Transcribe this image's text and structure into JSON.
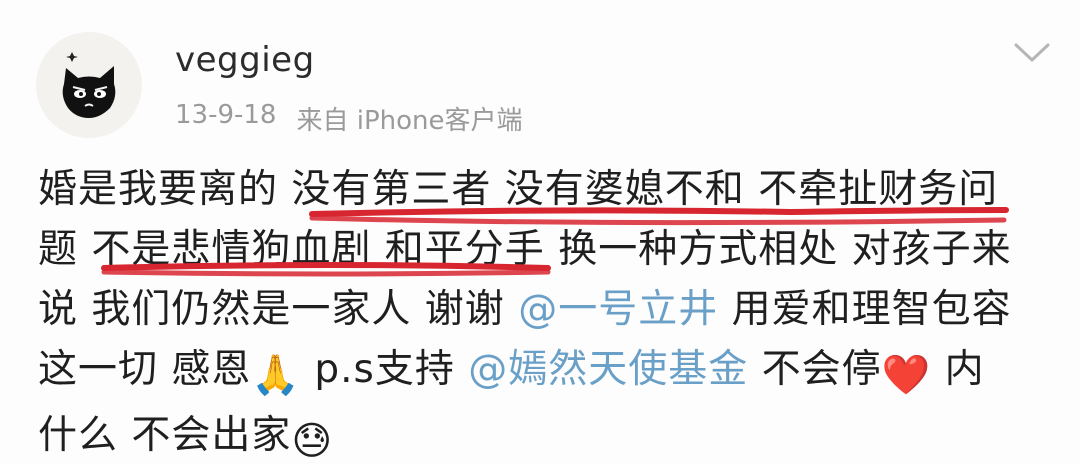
{
  "post": {
    "username": "veggieg",
    "date": "13-9-18",
    "source": "来自 iPhone客户端",
    "body_lines": [
      [
        {
          "t": "婚是我要离的 没有第三者 没有婆媳不和 不牵扯财务问",
          "m": false
        }
      ],
      [
        {
          "t": "题 不是悲情狗血剧 和平分手 换一种方式相处 对孩子来",
          "m": false
        }
      ],
      [
        {
          "t": "说 我们仍然是一家人 谢谢 ",
          "m": false
        },
        {
          "t": "@一号立井",
          "m": true
        },
        {
          "t": " 用爱和理智包容",
          "m": false
        }
      ],
      [
        {
          "t": "这一切 感恩",
          "m": false
        },
        {
          "t": "🙏",
          "e": "praying-hands-emoji"
        },
        {
          "t": " p.s支持 ",
          "m": false
        },
        {
          "t": "@嫣然天使基金",
          "m": true
        },
        {
          "t": " 不会停",
          "m": false
        },
        {
          "t": "❤️",
          "e": "red-heart-emoji"
        },
        {
          "t": " 内",
          "m": false
        }
      ],
      [
        {
          "t": "什么 不会出家",
          "m": false
        },
        {
          "t": "😓",
          "e": "downcast-sweat-emoji"
        }
      ]
    ]
  },
  "colors": {
    "mention": "#6aa0c8",
    "underline": "#d7262f",
    "meta": "#9a9a9a"
  },
  "icons": {
    "avatar": "black-cat-avatar",
    "menu": "chevron-down-icon"
  }
}
